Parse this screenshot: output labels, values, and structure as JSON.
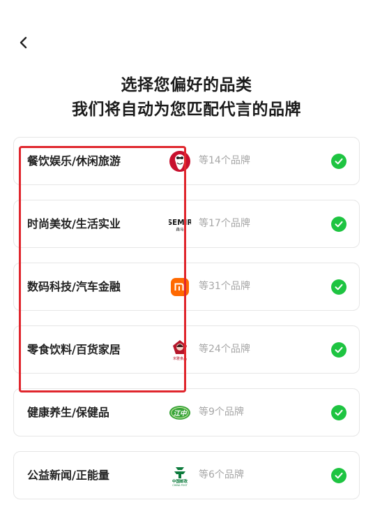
{
  "header": {
    "title_line1": "选择您偏好的品类",
    "title_line2": "我们将自动为您匹配代言的品牌"
  },
  "categories": [
    {
      "label": "餐饮娱乐/休闲旅游",
      "count": "等14个品牌",
      "logo": "kfc-logo",
      "selected": true
    },
    {
      "label": "时尚美妆/生活实业",
      "count": "等17个品牌",
      "logo": "semir-logo",
      "selected": true
    },
    {
      "label": "数码科技/汽车金融",
      "count": "等31个品牌",
      "logo": "xiaomi-logo",
      "selected": true
    },
    {
      "label": "零食饮料/百货家居",
      "count": "等24个品牌",
      "logo": "food-brand-logo",
      "selected": true
    },
    {
      "label": "健康养生/保健品",
      "count": "等9个品牌",
      "logo": "jiangzhong-logo",
      "selected": true
    },
    {
      "label": "公益新闻/正能量",
      "count": "等6个品牌",
      "logo": "china-post-logo",
      "selected": true
    }
  ],
  "logo_text": {
    "semir_main": "SEMIR",
    "semir_sub": "森马",
    "xiaomi": "mi",
    "jiangzhong": "江中",
    "china_post_cn": "中国邮政",
    "china_post_en": "CHINA POST",
    "food_brand": "米雅食品"
  },
  "colors": {
    "accent_check": "#1ec441",
    "highlight": "#e0262d",
    "muted_text": "#a6a6a6"
  }
}
